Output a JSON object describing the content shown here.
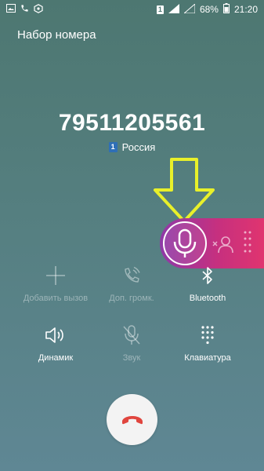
{
  "status_bar": {
    "sim_label": "1",
    "battery": "68%",
    "time": "21:20"
  },
  "title": "Набор номера",
  "phone_number": "79511205561",
  "country": {
    "sim_label": "1",
    "name": "Россия"
  },
  "controls": [
    {
      "id": "add-call",
      "label": "Добавить вызов",
      "enabled": false
    },
    {
      "id": "extra-volume",
      "label": "Доп. громк.",
      "enabled": false
    },
    {
      "id": "bluetooth",
      "label": "Bluetooth",
      "enabled": true
    },
    {
      "id": "speaker",
      "label": "Динамик",
      "enabled": true
    },
    {
      "id": "mute",
      "label": "Звук",
      "enabled": false
    },
    {
      "id": "keypad",
      "label": "Клавиатура",
      "enabled": true
    }
  ],
  "colors": {
    "arrow": "#e8f02a",
    "pill_start": "#8e3aa8",
    "pill_end": "#e0346f",
    "end_call": "#e0453e"
  }
}
